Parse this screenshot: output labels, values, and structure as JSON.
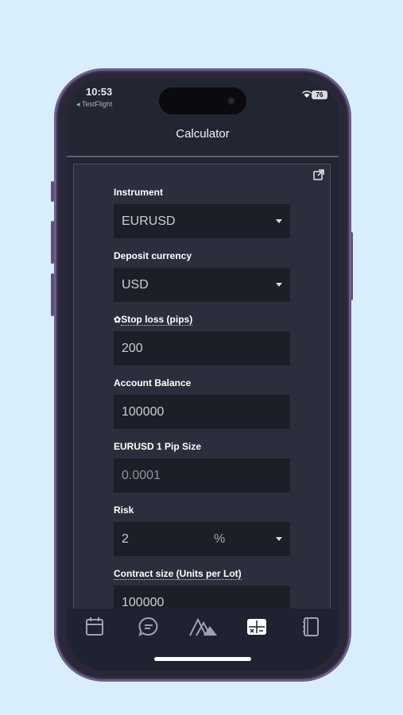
{
  "status_bar": {
    "time": "10:53",
    "back_app": "◂ TestFlight",
    "battery": "76"
  },
  "header": {
    "title": "Calculator"
  },
  "form": {
    "instrument_label": "Instrument",
    "instrument_value": "EURUSD",
    "deposit_label": "Deposit currency",
    "deposit_value": "USD",
    "stoploss_label": "Stop loss (pips)",
    "stoploss_value": "200",
    "balance_label": "Account Balance",
    "balance_value": "100000",
    "pipsize_label": "EURUSD 1 Pip Size",
    "pipsize_value": "0.0001",
    "risk_label": "Risk",
    "risk_value": "2",
    "risk_unit": "%",
    "contract_label": "Contract size (Units per Lot)",
    "contract_value": "100000"
  },
  "tabs": [
    {
      "icon": "calendar-icon"
    },
    {
      "icon": "chat-icon"
    },
    {
      "icon": "mountains-icon"
    },
    {
      "icon": "calculator-icon",
      "active": true
    },
    {
      "icon": "notebook-icon"
    }
  ],
  "colors": {
    "background": "#d8eefc",
    "screen": "#222633",
    "input": "#1c1f28",
    "phone_frame": "#6e5d8a"
  }
}
